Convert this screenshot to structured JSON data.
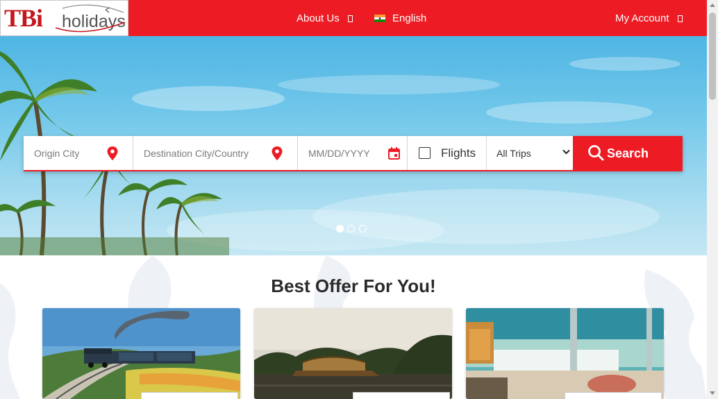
{
  "header": {
    "logo_text": "TBi",
    "logo_sub": "holidays",
    "about_label": "About Us",
    "language_label": "English",
    "account_label": "My Account",
    "flag_icon": "india-flag-icon"
  },
  "search": {
    "origin_placeholder": "Origin City",
    "destination_placeholder": "Destination City/Country",
    "date_placeholder": "MM/DD/YYYY",
    "flights_label": "Flights",
    "trips_selected": "All Trips",
    "search_label": "Search"
  },
  "carousel": {
    "slides": 3,
    "active_index": 0
  },
  "offers": {
    "title": "Best Offer For You!",
    "cards": [
      {
        "image": "toy-train-in-hills"
      },
      {
        "image": "kerala-houseboat"
      },
      {
        "image": "beach-cafe"
      }
    ]
  },
  "colors": {
    "brand_red": "#ed1c24",
    "text_dark": "#2b2b2b"
  }
}
